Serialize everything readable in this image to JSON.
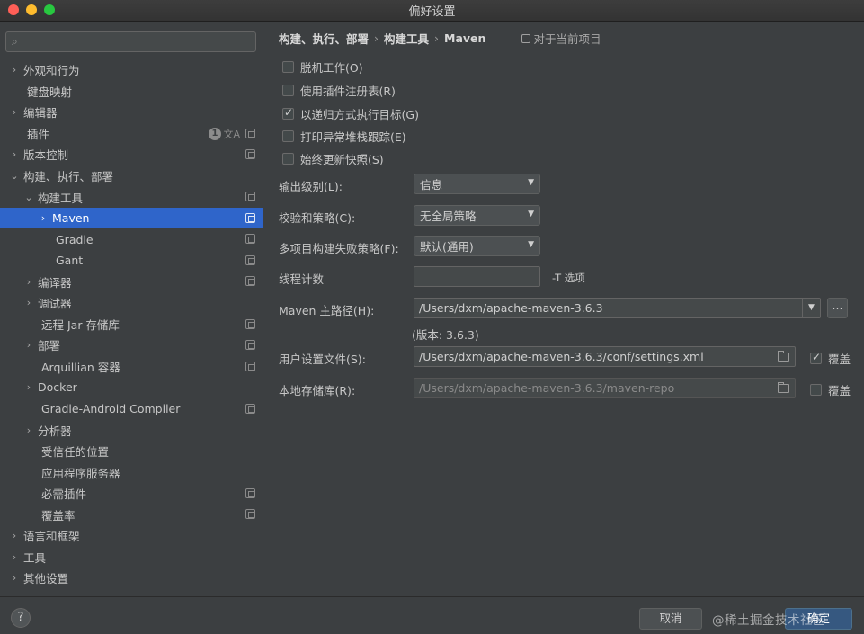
{
  "window": {
    "title": "偏好设置"
  },
  "search": {
    "placeholder": ""
  },
  "sidebar": {
    "plugin_badge": "1",
    "items": [
      {
        "label": "外观和行为"
      },
      {
        "label": "键盘映射"
      },
      {
        "label": "编辑器"
      },
      {
        "label": "插件"
      },
      {
        "label": "版本控制"
      },
      {
        "label": "构建、执行、部署"
      },
      {
        "label": "构建工具"
      },
      {
        "label": "Maven"
      },
      {
        "label": "Gradle"
      },
      {
        "label": "Gant"
      },
      {
        "label": "编译器"
      },
      {
        "label": "调试器"
      },
      {
        "label": "远程 Jar 存储库"
      },
      {
        "label": "部署"
      },
      {
        "label": "Arquillian 容器"
      },
      {
        "label": "Docker"
      },
      {
        "label": "Gradle-Android Compiler"
      },
      {
        "label": "分析器"
      },
      {
        "label": "受信任的位置"
      },
      {
        "label": "应用程序服务器"
      },
      {
        "label": "必需插件"
      },
      {
        "label": "覆盖率"
      },
      {
        "label": "语言和框架"
      },
      {
        "label": "工具"
      },
      {
        "label": "其他设置"
      }
    ]
  },
  "breadcrumb": {
    "parts": [
      "构建、执行、部署",
      "构建工具",
      "Maven"
    ],
    "project_scope": "对于当前项目"
  },
  "checkboxes": [
    {
      "label": "脱机工作(O)",
      "checked": false
    },
    {
      "label": "使用插件注册表(R)",
      "checked": false
    },
    {
      "label": "以递归方式执行目标(G)",
      "checked": true
    },
    {
      "label": "打印异常堆栈跟踪(E)",
      "checked": false
    },
    {
      "label": "始终更新快照(S)",
      "checked": false
    }
  ],
  "fields": {
    "output_level": {
      "label": "输出级别(L):",
      "value": "信息"
    },
    "checksum_policy": {
      "label": "校验和策略(C):",
      "value": "无全局策略"
    },
    "failure_policy": {
      "label": "多项目构建失败策略(F):",
      "value": "默认(通用)"
    },
    "thread_count": {
      "label": "线程计数",
      "value": "",
      "hint": "-T 选项"
    },
    "maven_home": {
      "label": "Maven 主路径(H):",
      "value": "/Users/dxm/apache-maven-3.6.3",
      "browse": "...",
      "version": "(版本: 3.6.3)"
    },
    "user_settings": {
      "label": "用户设置文件(S):",
      "value": "/Users/dxm/apache-maven-3.6.3/conf/settings.xml",
      "override_label": "覆盖",
      "override": true
    },
    "local_repo": {
      "label": "本地存储库(R):",
      "value": "/Users/dxm/apache-maven-3.6.3/maven-repo",
      "override_label": "覆盖",
      "override": false
    }
  },
  "footer": {
    "help": "?",
    "cancel": "取消",
    "ok": "确定",
    "watermark": "@稀土掘金技术社区"
  }
}
